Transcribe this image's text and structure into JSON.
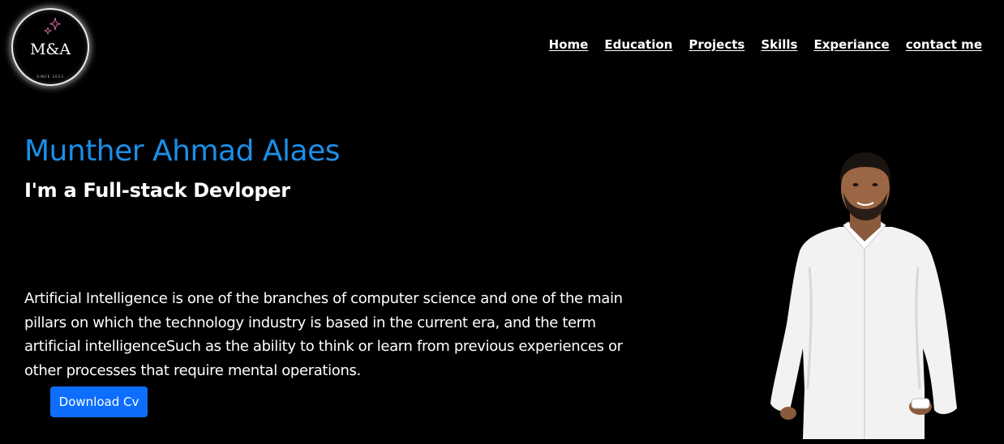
{
  "logo": {
    "text": "M&A",
    "since": "SINCE 2023",
    "border_color": "#e9e9e9",
    "star_color": "#d36ba6"
  },
  "nav": {
    "items": [
      {
        "label": "Home"
      },
      {
        "label": "Education"
      },
      {
        "label": "Projects"
      },
      {
        "label": "Skills"
      },
      {
        "label": "Experiance"
      },
      {
        "label": "contact me"
      }
    ]
  },
  "hero": {
    "name": "Munther Ahmad Alaes",
    "title": "I'm a Full-stack Devloper",
    "description": "Artificial Intelligence is one of the branches of computer science and one of the main pillars on which the technology industry is based in the current era, and the term artificial intelligenceSuch as the ability to think or learn from previous experiences or other processes that require mental operations.",
    "cv_button_label": "Download Cv",
    "name_color": "#1a8fe8",
    "button_color": "#0d6efd"
  },
  "portrait": {
    "icon": "person-photo"
  }
}
